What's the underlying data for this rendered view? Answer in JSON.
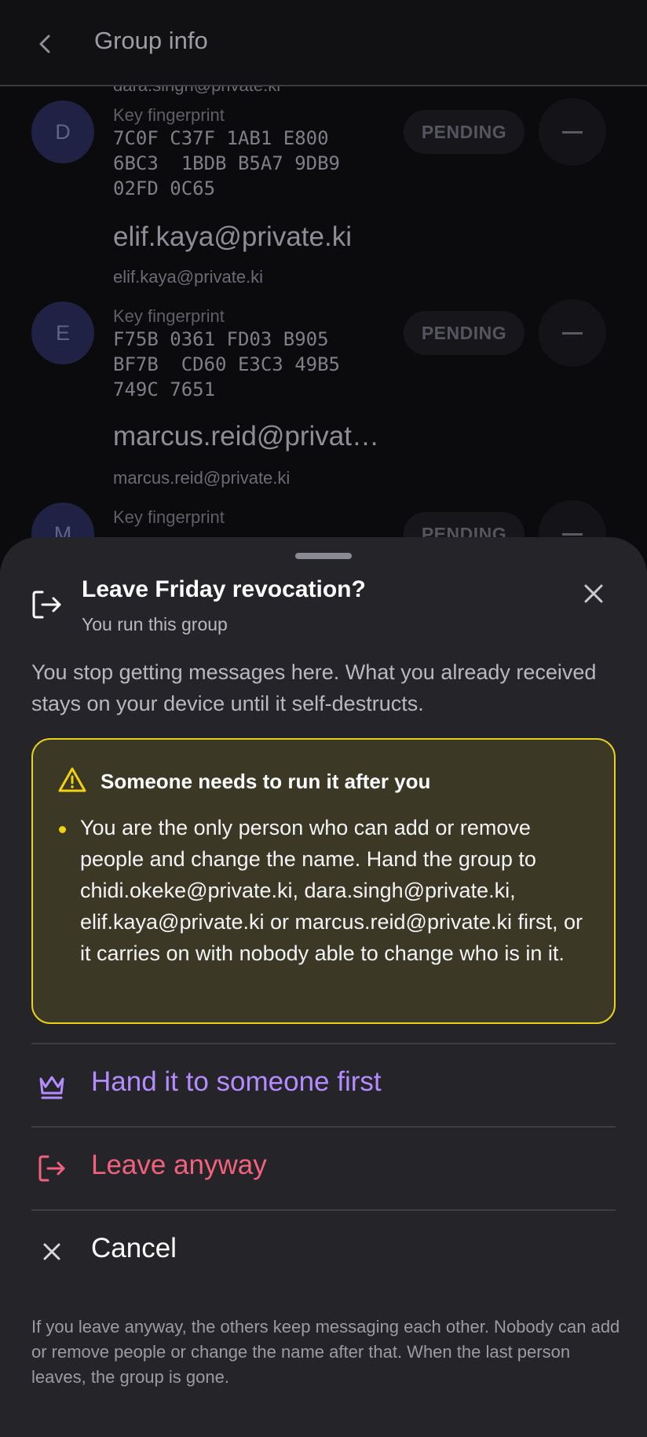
{
  "header": {
    "title": "Group info",
    "back_icon": "chevron-left-icon"
  },
  "members": [
    {
      "avatar": "D",
      "name": "",
      "email": "dara.singh@private.ki",
      "key_label": "Key fingerprint",
      "fingerprint": "7C0F C37F 1AB1 E800\n6BC3  1BDB B5A7 9DB9\n02FD 0C65",
      "status": "PENDING"
    },
    {
      "avatar": "E",
      "name": "elif.kaya@private.ki",
      "email": "elif.kaya@private.ki",
      "key_label": "Key fingerprint",
      "fingerprint": "F75B 0361 FD03 B905\nBF7B  CD60 E3C3 49B5\n749C 7651",
      "status": "PENDING"
    },
    {
      "avatar": "M",
      "name": "marcus.reid@privat…",
      "email": "marcus.reid@private.ki",
      "key_label": "Key fingerprint",
      "fingerprint": "",
      "status": "PENDING"
    }
  ],
  "sheet": {
    "title": "Leave Friday revocation?",
    "subtitle": "You run this group",
    "description": "You stop getting messages here. What you already received stays on your device until it self-destructs.",
    "warning": {
      "title": "Someone needs to run it after you",
      "body": "You are the only person who can add or remove people and change the name. Hand the group to chidi.okeke@private.ki, dara.singh@private.ki, elif.kaya@private.ki or marcus.reid@private.ki first, or it carries on with nobody able to change who is in it.",
      "accent": "#e6d21c"
    },
    "actions": {
      "hand_over": {
        "label": "Hand it to someone first",
        "icon": "crown-icon",
        "color": "#b48cff"
      },
      "leave": {
        "label": "Leave anyway",
        "icon": "leave-icon",
        "color": "#f2617e"
      },
      "cancel": {
        "label": "Cancel",
        "icon": "close-icon",
        "color": "#ffffff"
      }
    },
    "footnote": "If you leave anyway, the others keep messaging each other. Nobody can add or remove people or change the name after that. When the last person leaves, the group is gone."
  }
}
